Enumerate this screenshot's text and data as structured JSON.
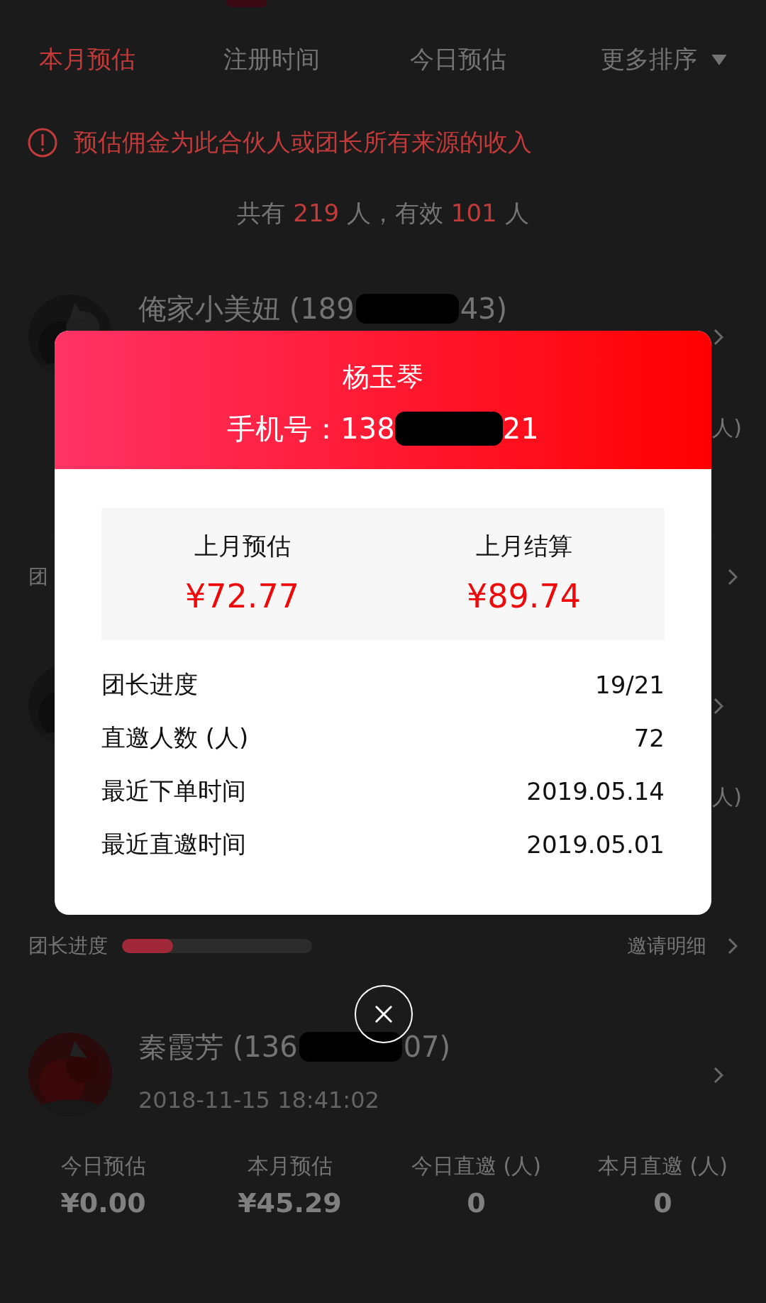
{
  "tabs": [
    {
      "label": "本月预估",
      "selected": true,
      "kind": "plain"
    },
    {
      "label": "注册时间",
      "selected": false,
      "kind": "plain"
    },
    {
      "label": "今日预估",
      "selected": false,
      "kind": "plain"
    },
    {
      "label": "更多排序",
      "selected": false,
      "kind": "dropdown"
    }
  ],
  "notice": {
    "text": "预估佣金为此合伙人或团长所有来源的收入"
  },
  "summary": [
    {
      "text": "共有",
      "highlight": false
    },
    {
      "text": "219",
      "highlight": true
    },
    {
      "text": "人，有效",
      "highlight": false
    },
    {
      "text": "101",
      "highlight": true
    },
    {
      "text": "人",
      "highlight": false
    }
  ],
  "members": [
    {
      "name": "俺家小美妞 (189",
      "name_tail": "43)",
      "stat_fragment": "人)",
      "team_label": "团"
    },
    {
      "stat_fragment": "人)",
      "team_label": "团长进度",
      "level": 0.27,
      "invite_link": "邀请明细"
    },
    {
      "name": "秦霞芳 (136",
      "name_tail": "07)",
      "date": "2018-11-15 18:41:02",
      "stats": [
        {
          "label": "今日预估",
          "value": "¥0.00"
        },
        {
          "label": "本月预估",
          "value": "¥45.29"
        },
        {
          "label": "今日直邀 (人)",
          "value": "0"
        },
        {
          "label": "本月直邀 (人)",
          "value": "0"
        }
      ]
    }
  ],
  "modal": {
    "name": "杨玉琴",
    "phone_start": "手机号：138",
    "phone_end": "21",
    "summary": [
      {
        "label": "上月预估",
        "value": "¥72.77"
      },
      {
        "label": "上月结算",
        "value": "¥89.74"
      }
    ],
    "rows": [
      {
        "label": "团长进度",
        "value": "19/21"
      },
      {
        "label": "直邀人数 (人)",
        "value": "72"
      },
      {
        "label": "最近下单时间",
        "value": "2019.05.14"
      },
      {
        "label": "最近直邀时间",
        "value": "2019.05.01"
      }
    ]
  }
}
